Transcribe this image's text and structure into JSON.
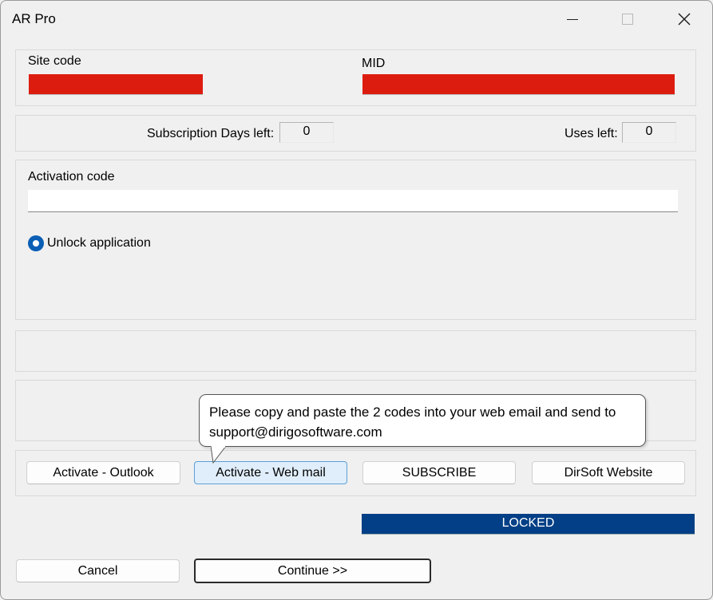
{
  "window": {
    "title": "AR Pro"
  },
  "ids": {
    "site_code_label": "Site code",
    "mid_label": "MID"
  },
  "subscription": {
    "days_label": "Subscription Days left:",
    "days_value": "0",
    "uses_label": "Uses left:",
    "uses_value": "0"
  },
  "activation": {
    "label": "Activation code",
    "value": "",
    "radio_label": "Unlock application"
  },
  "tooltip": {
    "line1": "Please copy and paste the 2 codes into your web email and send to",
    "line2": "support@dirigosoftware.com"
  },
  "buttons": {
    "activate_outlook": "Activate - Outlook",
    "activate_webmail": "Activate - Web mail",
    "subscribe": "SUBSCRIBE",
    "website": "DirSoft Website",
    "cancel": "Cancel",
    "continue": "Continue >>"
  },
  "status": {
    "text": "LOCKED",
    "color": "#023f86"
  },
  "colors": {
    "redacted": "#dd1c10",
    "radio": "#0a5fb5"
  }
}
